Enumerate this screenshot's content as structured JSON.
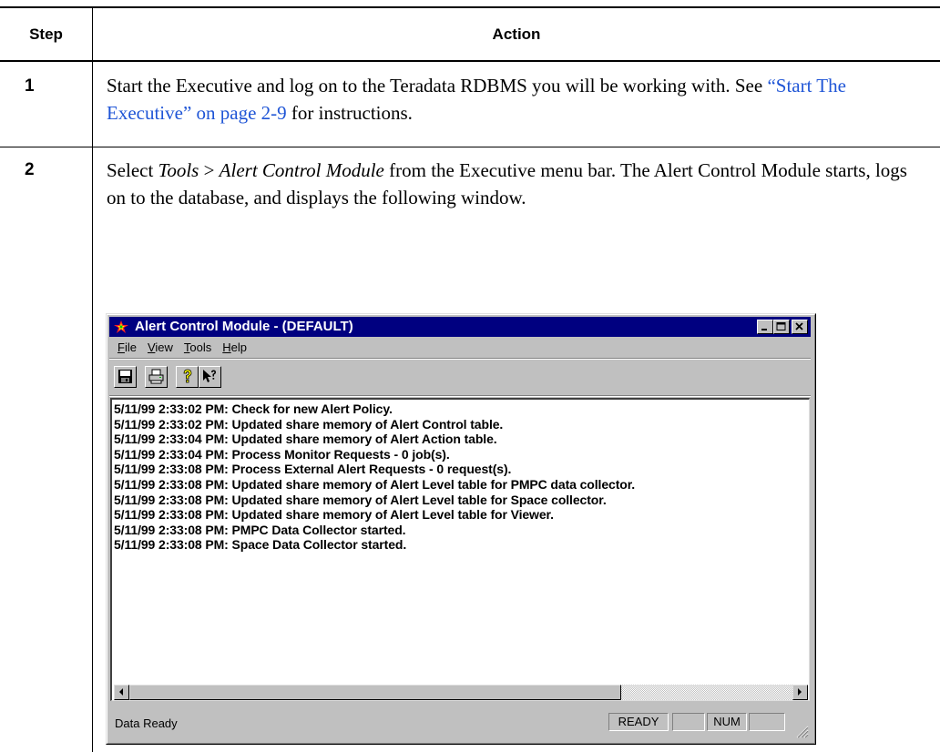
{
  "table": {
    "headers": {
      "step": "Step",
      "action": "Action"
    },
    "rows": [
      {
        "step": "1",
        "text_before": "Start the Executive and log on to the Teradata RDBMS you will be working with. See ",
        "xref": "“Start The Executive” on page 2-9",
        "text_after": " for instructions."
      },
      {
        "step": "2",
        "text_select": "Select ",
        "menu_tools": "Tools",
        "menu_gt": " > ",
        "menu_acm": "Alert Control Module",
        "text_rest": " from the Executive menu bar. The Alert Control Module starts, logs on to the database, and displays the following window."
      }
    ]
  },
  "window": {
    "title": "Alert Control Module - (DEFAULT)",
    "menu": [
      {
        "accel": "F",
        "rest": "ile"
      },
      {
        "accel": "V",
        "rest": "iew"
      },
      {
        "accel": "T",
        "rest": "ools"
      },
      {
        "accel": "H",
        "rest": "elp"
      }
    ],
    "toolbar_icons": [
      "save-icon",
      "print-icon",
      "help-icon",
      "whats-this-help-icon"
    ],
    "log_lines": [
      "5/11/99 2:33:02 PM: Check for new Alert Policy.",
      "5/11/99 2:33:02 PM: Updated share memory of Alert Control table.",
      "5/11/99 2:33:04 PM: Updated share memory of Alert Action table.",
      "5/11/99 2:33:04 PM: Process Monitor Requests - 0 job(s).",
      "5/11/99 2:33:08 PM: Process External Alert Requests - 0 request(s).",
      "5/11/99 2:33:08 PM: Updated share memory of Alert Level table for PMPC data collector.",
      "5/11/99 2:33:08 PM: Updated share memory of Alert Level table for Space collector.",
      "5/11/99 2:33:08 PM: Updated share memory of Alert Level table for Viewer.",
      "5/11/99 2:33:08 PM: PMPC Data Collector started.",
      "5/11/99 2:33:08 PM: Space Data Collector started."
    ],
    "status": {
      "text": "Data Ready",
      "ready": "READY",
      "num": "NUM"
    },
    "colors": {
      "titlebar": "#000080",
      "face": "#c0c0c0",
      "link": "#1f55d6"
    }
  }
}
